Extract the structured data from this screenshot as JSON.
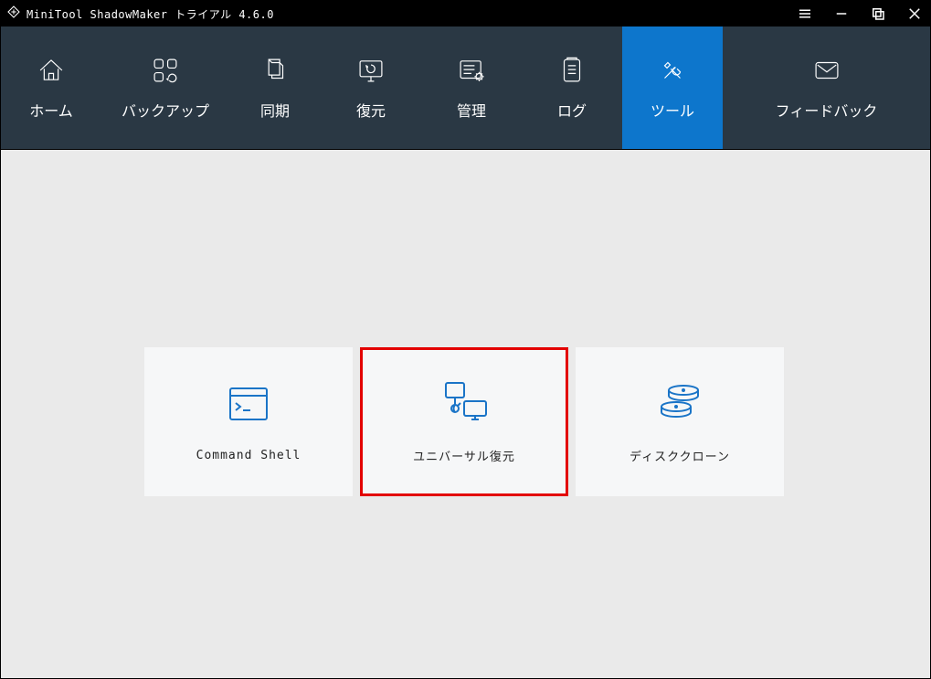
{
  "window": {
    "title": "MiniTool ShadowMaker トライアル 4.6.0"
  },
  "nav": {
    "home": "ホーム",
    "backup": "バックアップ",
    "sync": "同期",
    "restore": "復元",
    "manage": "管理",
    "log": "ログ",
    "tool": "ツール",
    "feedback": "フィードバック"
  },
  "tools": {
    "command_shell": "Command Shell",
    "universal_restore": "ユニバーサル復元",
    "disk_clone": "ディスククローン"
  },
  "colors": {
    "titlebar": "#000000",
    "navbar": "#2a3844",
    "active": "#0d76cc",
    "accent": "#1a74c7",
    "highlight": "#e30000",
    "tile_bg": "#f6f7f8",
    "content_bg": "#eaeaea"
  }
}
